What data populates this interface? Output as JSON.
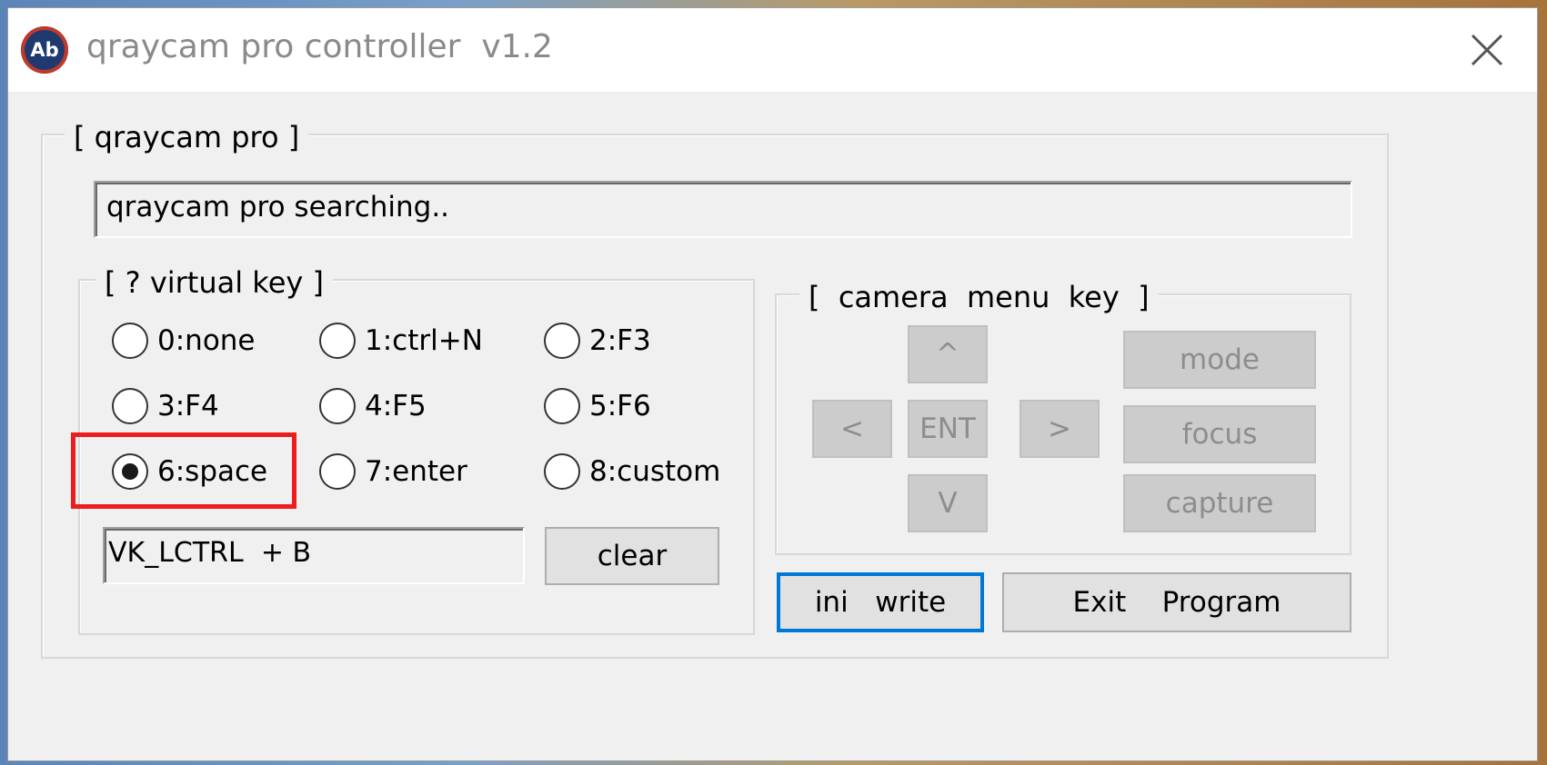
{
  "window": {
    "title": "qraycam pro controller  v1.2",
    "icon_text": "Ab"
  },
  "device_group": {
    "title": "[ qraycam pro ]",
    "status_text": "qraycam pro searching.."
  },
  "virtual_key_group": {
    "title": "[ ? virtual key ]",
    "options": [
      {
        "label": "0:none",
        "selected": false
      },
      {
        "label": "1:ctrl+N",
        "selected": false
      },
      {
        "label": "2:F3",
        "selected": false
      },
      {
        "label": "3:F4",
        "selected": false
      },
      {
        "label": "4:F5",
        "selected": false
      },
      {
        "label": "5:F6",
        "selected": false
      },
      {
        "label": "6:space",
        "selected": true
      },
      {
        "label": "7:enter",
        "selected": false
      },
      {
        "label": "8:custom",
        "selected": false
      }
    ],
    "custom_key_value": "VK_LCTRL  + B",
    "clear_label": "clear"
  },
  "camera_menu_group": {
    "title": "[  camera  menu  key  ]",
    "up_label": "^",
    "left_label": "<",
    "enter_label": "ENT",
    "right_label": ">",
    "down_label": "V",
    "mode_label": "mode",
    "focus_label": "focus",
    "capture_label": "capture"
  },
  "footer": {
    "ini_write_label": "ini   write",
    "exit_label": "Exit    Program"
  },
  "colors": {
    "highlight": "#ee1c1c",
    "focus_border": "#0078d7"
  }
}
